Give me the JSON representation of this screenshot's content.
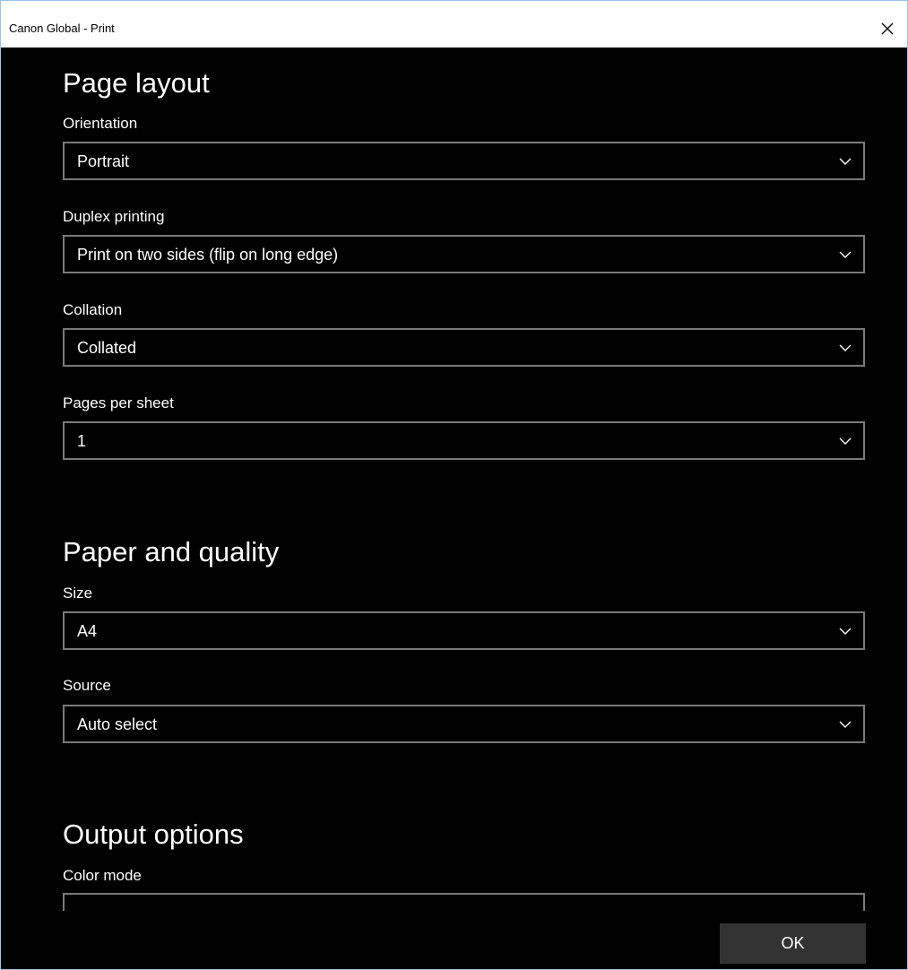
{
  "window": {
    "title": "Canon Global - Print",
    "close_icon": "close-icon"
  },
  "page_layout": {
    "heading": "Page layout",
    "orientation": {
      "label": "Orientation",
      "value": "Portrait"
    },
    "duplex": {
      "label": "Duplex printing",
      "value": "Print on two sides (flip on long edge)"
    },
    "collation": {
      "label": "Collation",
      "value": "Collated"
    },
    "pages_per_sheet": {
      "label": "Pages per sheet",
      "value": "1"
    }
  },
  "paper_quality": {
    "heading": "Paper and quality",
    "size": {
      "label": "Size",
      "value": "A4"
    },
    "source": {
      "label": "Source",
      "value": "Auto select"
    }
  },
  "output_options": {
    "heading": "Output options",
    "color_mode": {
      "label": "Color mode"
    }
  },
  "footer": {
    "ok_label": "OK"
  },
  "colors": {
    "background": "#000000",
    "titlebar": "#ffffff",
    "field_border": "#7a7a7a",
    "button_bg": "#333333",
    "window_border": "#9ec3e6"
  }
}
